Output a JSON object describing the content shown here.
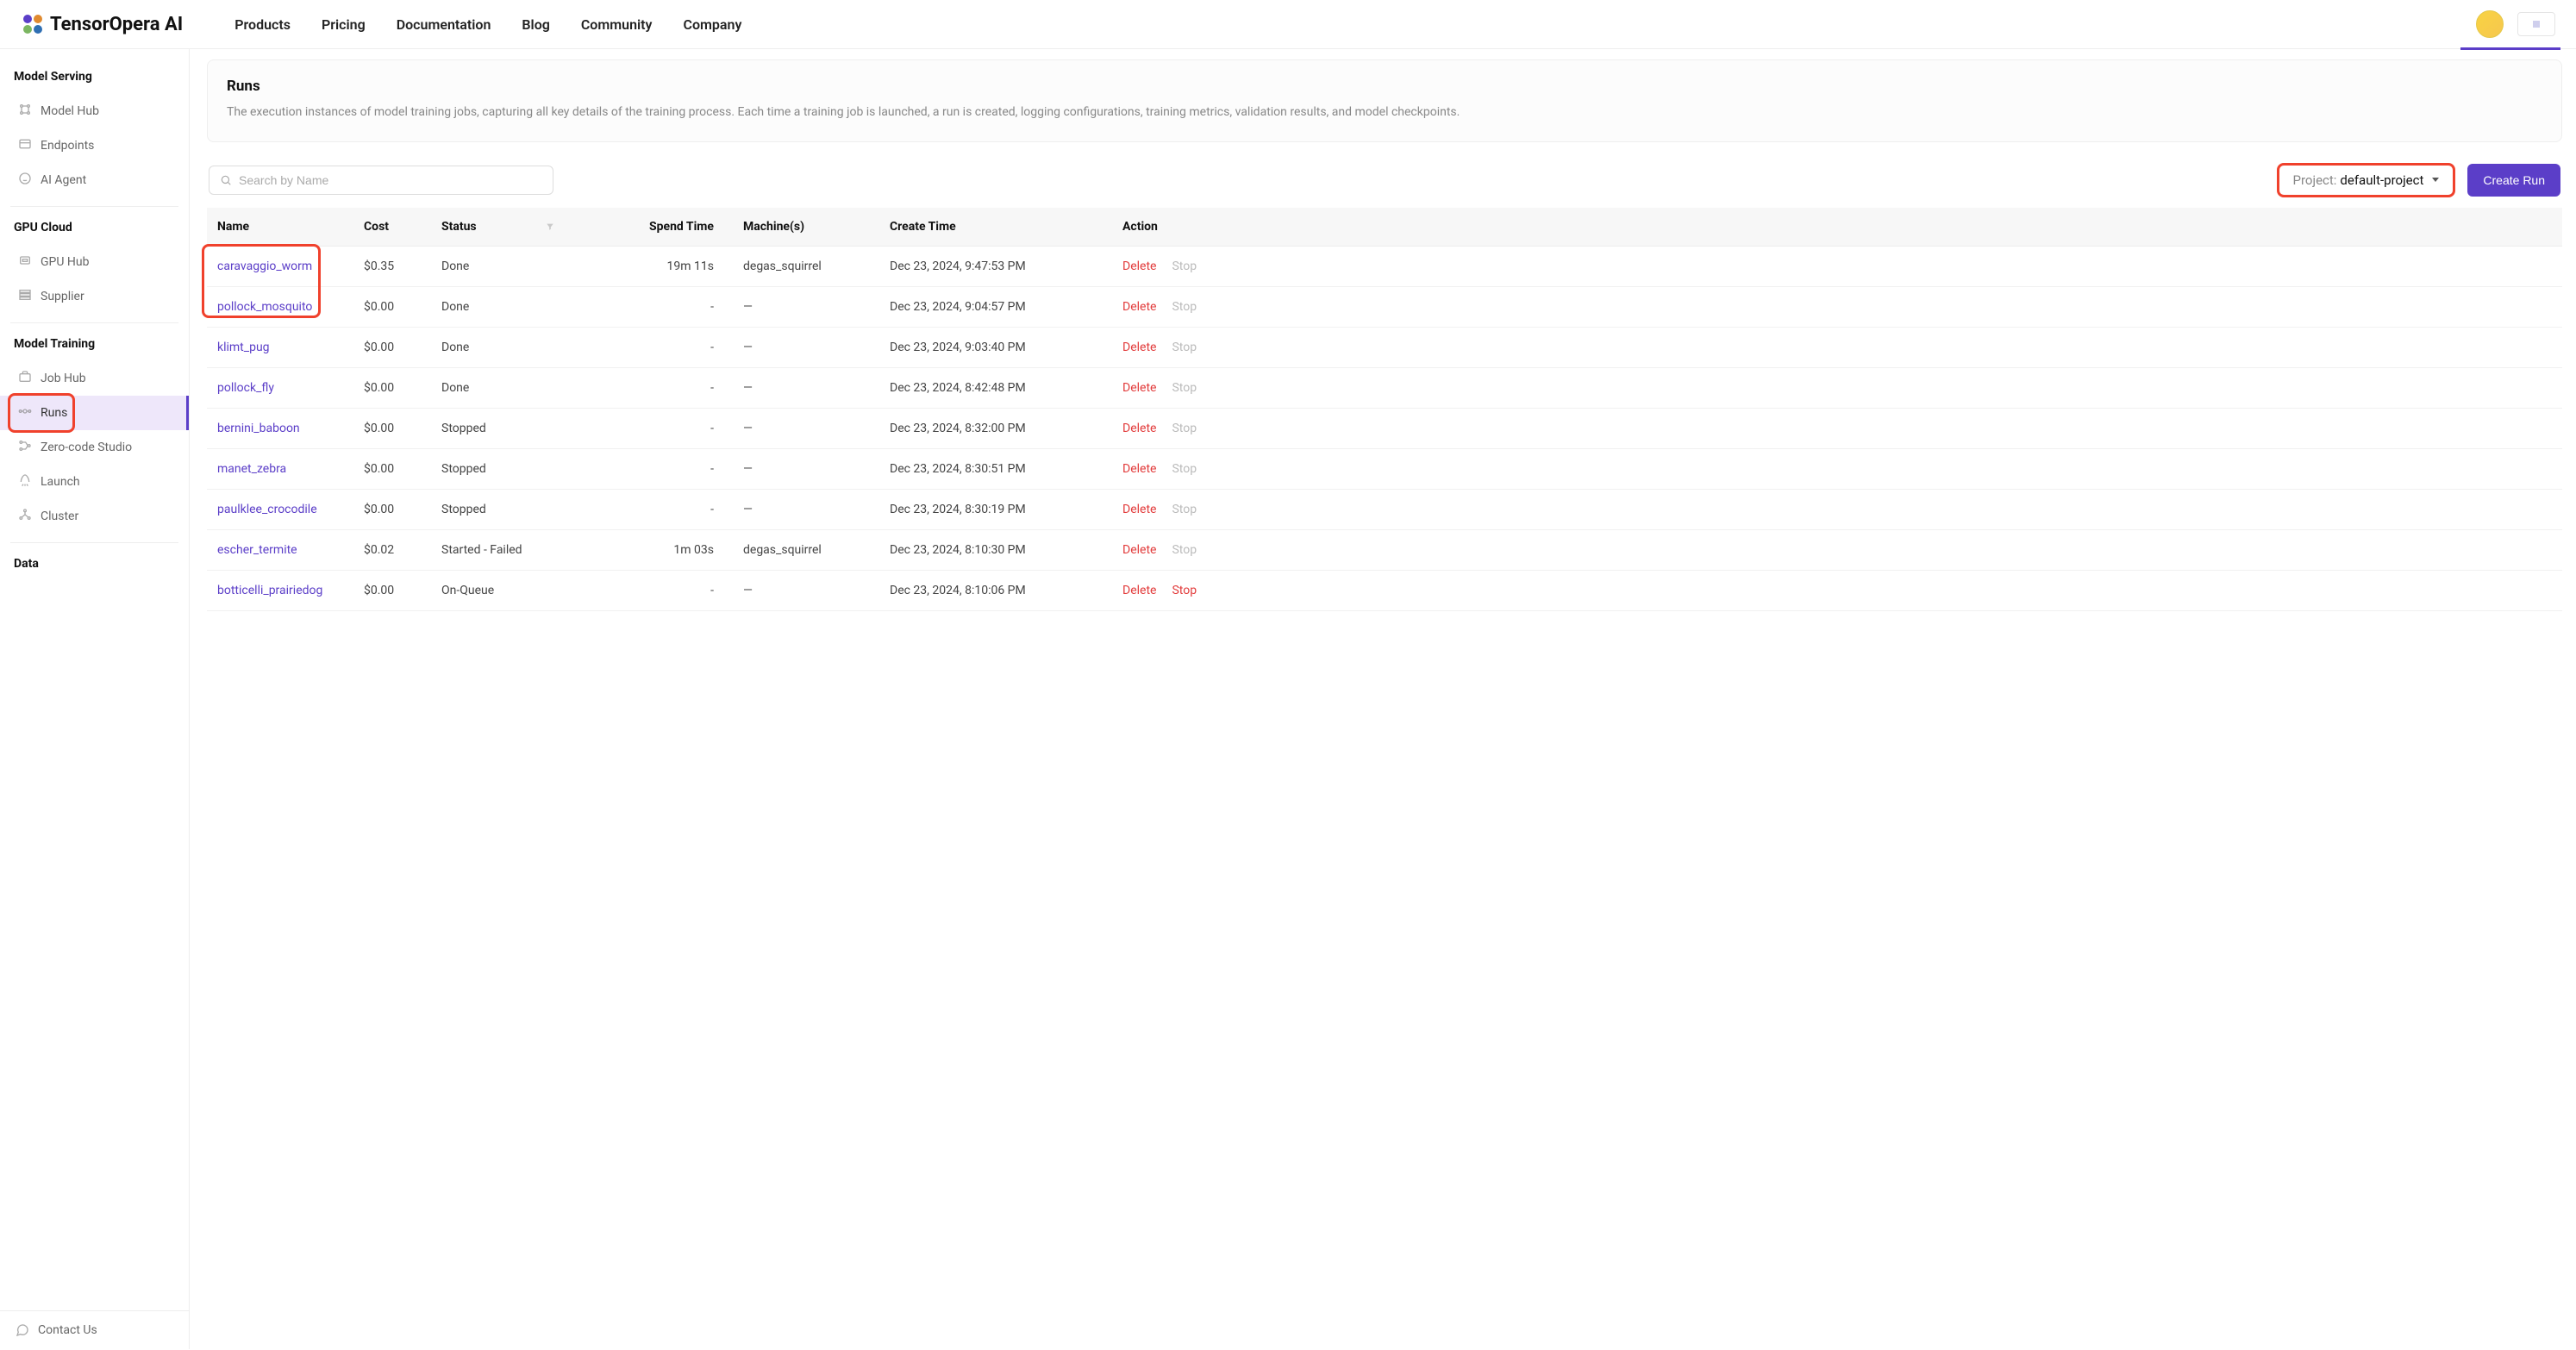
{
  "brand": "TensorOpera AI",
  "top_nav": [
    "Products",
    "Pricing",
    "Documentation",
    "Blog",
    "Community",
    "Company"
  ],
  "sidebar": {
    "sections": [
      {
        "title": "Model Serving",
        "items": [
          {
            "label": "Model Hub",
            "id": "model-hub"
          },
          {
            "label": "Endpoints",
            "id": "endpoints"
          },
          {
            "label": "AI Agent",
            "id": "ai-agent"
          }
        ]
      },
      {
        "title": "GPU Cloud",
        "items": [
          {
            "label": "GPU Hub",
            "id": "gpu-hub"
          },
          {
            "label": "Supplier",
            "id": "supplier"
          }
        ]
      },
      {
        "title": "Model Training",
        "items": [
          {
            "label": "Job Hub",
            "id": "job-hub"
          },
          {
            "label": "Runs",
            "id": "runs",
            "active": true
          },
          {
            "label": "Zero-code Studio",
            "id": "zero-code-studio"
          },
          {
            "label": "Launch",
            "id": "launch"
          },
          {
            "label": "Cluster",
            "id": "cluster"
          }
        ]
      },
      {
        "title": "Data",
        "items": []
      }
    ],
    "contact": "Contact Us"
  },
  "page": {
    "title": "Runs",
    "desc": "The execution instances of model training jobs, capturing all key details of the training process. Each time a training job is launched, a run is created, logging configurations, training metrics, validation results, and model checkpoints."
  },
  "search_placeholder": "Search by Name",
  "project_label": "Project:",
  "project_value": "default-project",
  "create_run_label": "Create Run",
  "table": {
    "headers": {
      "name": "Name",
      "cost": "Cost",
      "status": "Status",
      "spend": "Spend Time",
      "machines": "Machine(s)",
      "create": "Create Time",
      "action": "Action"
    },
    "delete_label": "Delete",
    "stop_label": "Stop",
    "rows": [
      {
        "name": "caravaggio_worm",
        "cost": "$0.35",
        "status": "Done",
        "spend": "19m 11s",
        "machines": "degas_squirrel",
        "create": "Dec 23, 2024, 9:47:53 PM",
        "stop_enabled": false
      },
      {
        "name": "pollock_mosquito",
        "cost": "$0.00",
        "status": "Done",
        "spend": "-",
        "machines": "—",
        "create": "Dec 23, 2024, 9:04:57 PM",
        "stop_enabled": false
      },
      {
        "name": "klimt_pug",
        "cost": "$0.00",
        "status": "Done",
        "spend": "-",
        "machines": "—",
        "create": "Dec 23, 2024, 9:03:40 PM",
        "stop_enabled": false
      },
      {
        "name": "pollock_fly",
        "cost": "$0.00",
        "status": "Done",
        "spend": "-",
        "machines": "—",
        "create": "Dec 23, 2024, 8:42:48 PM",
        "stop_enabled": false
      },
      {
        "name": "bernini_baboon",
        "cost": "$0.00",
        "status": "Stopped",
        "spend": "-",
        "machines": "—",
        "create": "Dec 23, 2024, 8:32:00 PM",
        "stop_enabled": false
      },
      {
        "name": "manet_zebra",
        "cost": "$0.00",
        "status": "Stopped",
        "spend": "-",
        "machines": "—",
        "create": "Dec 23, 2024, 8:30:51 PM",
        "stop_enabled": false
      },
      {
        "name": "paulklee_crocodile",
        "cost": "$0.00",
        "status": "Stopped",
        "spend": "-",
        "machines": "—",
        "create": "Dec 23, 2024, 8:30:19 PM",
        "stop_enabled": false
      },
      {
        "name": "escher_termite",
        "cost": "$0.02",
        "status": "Started - Failed",
        "spend": "1m 03s",
        "machines": "degas_squirrel",
        "create": "Dec 23, 2024, 8:10:30 PM",
        "stop_enabled": false
      },
      {
        "name": "botticelli_prairiedog",
        "cost": "$0.00",
        "status": "On-Queue",
        "spend": "-",
        "machines": "—",
        "create": "Dec 23, 2024, 8:10:06 PM",
        "stop_enabled": true
      }
    ]
  }
}
